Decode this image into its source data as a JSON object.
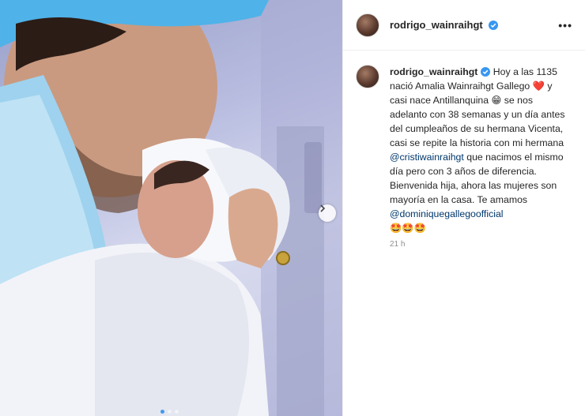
{
  "post": {
    "username": "rodrigo_wainraihgt",
    "verified": true,
    "more_label": "•••",
    "caption": {
      "username": "rodrigo_wainraihgt",
      "part1": "Hoy a las 1135 nació Amalia Wainraihgt Gallego",
      "heart": "❤️",
      "part2": "y casi nace Antillanquina",
      "emoji_face": "😁",
      "part3": "se nos adelanto con 38 semanas y un día antes del cumpleaños de su hermana Vicenta, casi se repite la historia con mi hermana",
      "mention1": "@cristiwainraihgt",
      "part4": "que nacimos el mismo día pero con 3 años de diferencia. Bienvenida hija, ahora las mujeres son mayoría en la casa. Te amamos",
      "mention2": "@dominiquegallegoofficial",
      "emoji_end": "🤩🤩🤩"
    },
    "timestamp": "21 h",
    "carousel": {
      "current": 1,
      "total": 3
    }
  },
  "colors": {
    "accent": "#3f9bf0",
    "mention": "#00376b",
    "verified": "#3897f0",
    "heart": "#e0245e"
  },
  "icons": {
    "verified": "verified-badge-icon",
    "next": "chevron-right-icon",
    "more": "more-options-icon"
  }
}
